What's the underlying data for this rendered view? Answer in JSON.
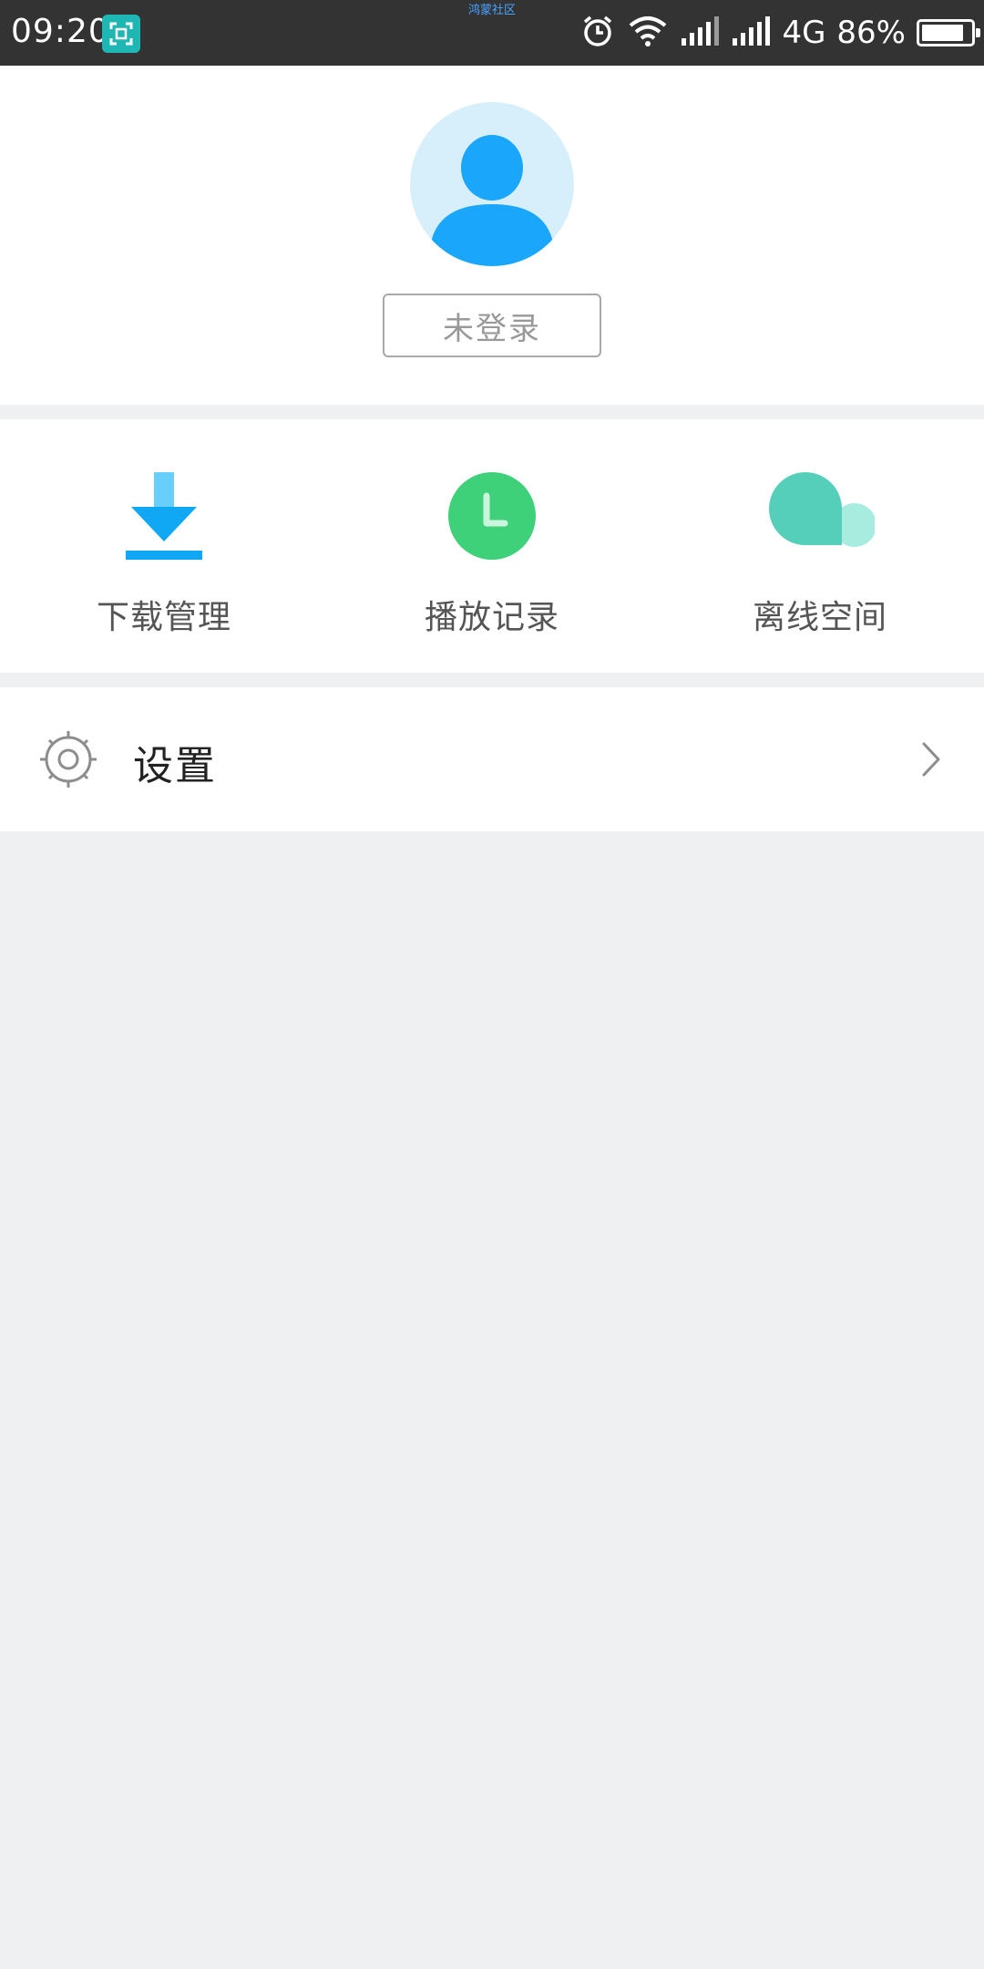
{
  "status_bar": {
    "time": "09:20",
    "center_text": "鸿蒙社区",
    "network": "4G",
    "battery_percent_label": "86%",
    "battery_level": 0.86,
    "icons": [
      "screenshot-app-icon",
      "alarm-icon",
      "wifi-icon",
      "signal-icon",
      "signal-icon",
      "battery-icon"
    ]
  },
  "profile": {
    "avatar_icon": "avatar-icon",
    "login_label": "未登录"
  },
  "quick_actions": [
    {
      "label": "下载管理",
      "icon": "download-icon",
      "color": "#1aa9f4"
    },
    {
      "label": "播放记录",
      "icon": "clock-icon",
      "color": "#3fd17a"
    },
    {
      "label": "离线空间",
      "icon": "cloud-icon",
      "color": "#55d0bb"
    }
  ],
  "settings": {
    "label": "设置",
    "icon": "gear-icon",
    "chevron_icon": "chevron-right-icon"
  },
  "colors": {
    "background": "#eef0f2",
    "status_bar": "#333333",
    "accent_blue": "#1aa9f4"
  }
}
